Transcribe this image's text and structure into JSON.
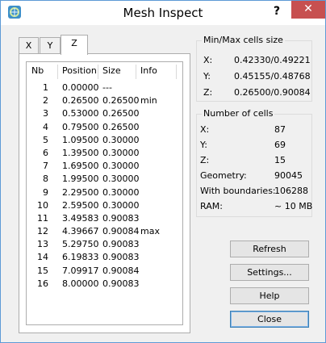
{
  "window": {
    "title": "Mesh Inspect",
    "help_label": "?",
    "close_label": "✕"
  },
  "tabs": [
    {
      "label": "X"
    },
    {
      "label": "Y"
    },
    {
      "label": "Z"
    }
  ],
  "table": {
    "headers": {
      "nb": "Nb",
      "position": "Position",
      "size": "Size",
      "info": "Info"
    },
    "rows": [
      {
        "nb": "1",
        "position": "0.00000",
        "size": "---",
        "info": ""
      },
      {
        "nb": "2",
        "position": "0.26500",
        "size": "0.26500",
        "info": "min"
      },
      {
        "nb": "3",
        "position": "0.53000",
        "size": "0.26500",
        "info": ""
      },
      {
        "nb": "4",
        "position": "0.79500",
        "size": "0.26500",
        "info": ""
      },
      {
        "nb": "5",
        "position": "1.09500",
        "size": "0.30000",
        "info": ""
      },
      {
        "nb": "6",
        "position": "1.39500",
        "size": "0.30000",
        "info": ""
      },
      {
        "nb": "7",
        "position": "1.69500",
        "size": "0.30000",
        "info": ""
      },
      {
        "nb": "8",
        "position": "1.99500",
        "size": "0.30000",
        "info": ""
      },
      {
        "nb": "9",
        "position": "2.29500",
        "size": "0.30000",
        "info": ""
      },
      {
        "nb": "10",
        "position": "2.59500",
        "size": "0.30000",
        "info": ""
      },
      {
        "nb": "11",
        "position": "3.49583",
        "size": "0.90083",
        "info": ""
      },
      {
        "nb": "12",
        "position": "4.39667",
        "size": "0.90084",
        "info": "max"
      },
      {
        "nb": "13",
        "position": "5.29750",
        "size": "0.90083",
        "info": ""
      },
      {
        "nb": "14",
        "position": "6.19833",
        "size": "0.90083",
        "info": ""
      },
      {
        "nb": "15",
        "position": "7.09917",
        "size": "0.90084",
        "info": ""
      },
      {
        "nb": "16",
        "position": "8.00000",
        "size": "0.90083",
        "info": ""
      }
    ]
  },
  "minmax": {
    "title": "Min/Max cells size",
    "x_label": "X:",
    "x_value": "0.42330/0.49221",
    "y_label": "Y:",
    "y_value": "0.45155/0.48768",
    "z_label": "Z:",
    "z_value": "0.26500/0.90084"
  },
  "cells": {
    "title": "Number of cells",
    "x_label": "X:",
    "x_value": "87",
    "y_label": "Y:",
    "y_value": "69",
    "z_label": "Z:",
    "z_value": "15",
    "geometry_label": "Geometry:",
    "geometry_value": "90045",
    "boundaries_label": "With boundaries:",
    "boundaries_value": "106288",
    "ram_label": "RAM:",
    "ram_value": "~ 10 MB"
  },
  "buttons": {
    "refresh": "Refresh",
    "settings": "Settings...",
    "help": "Help",
    "close": "Close"
  }
}
